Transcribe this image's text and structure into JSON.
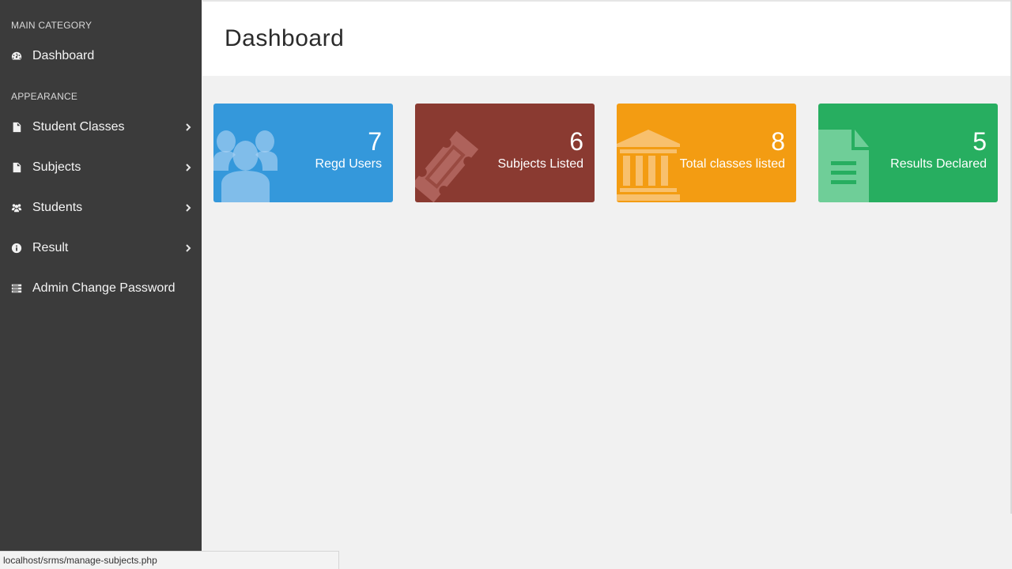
{
  "sidebar": {
    "main_category": "MAIN CATEGORY",
    "appearance": "APPEARANCE",
    "items": [
      {
        "label": "Dashboard",
        "icon": "dashboard-gauge-icon",
        "has_submenu": false
      },
      {
        "label": "Student Classes",
        "icon": "file-icon",
        "has_submenu": true
      },
      {
        "label": "Subjects",
        "icon": "file-icon",
        "has_submenu": true
      },
      {
        "label": "Students",
        "icon": "users-icon",
        "has_submenu": true
      },
      {
        "label": "Result",
        "icon": "info-icon",
        "has_submenu": true
      },
      {
        "label": "Admin Change Password",
        "icon": "server-icon",
        "has_submenu": false
      }
    ]
  },
  "header": {
    "title": "Dashboard"
  },
  "cards": [
    {
      "count": "7",
      "label": "Regd Users",
      "icon": "users-icon",
      "color": "#3498db"
    },
    {
      "count": "6",
      "label": "Subjects Listed",
      "icon": "ticket-icon",
      "color": "#8a3a31"
    },
    {
      "count": "8",
      "label": "Total classes listed",
      "icon": "bank-icon",
      "color": "#f39c12"
    },
    {
      "count": "5",
      "label": "Results Declared",
      "icon": "file-text-icon",
      "color": "#27ae60"
    }
  ],
  "statusbar": {
    "url": "localhost/srms/manage-subjects.php"
  }
}
